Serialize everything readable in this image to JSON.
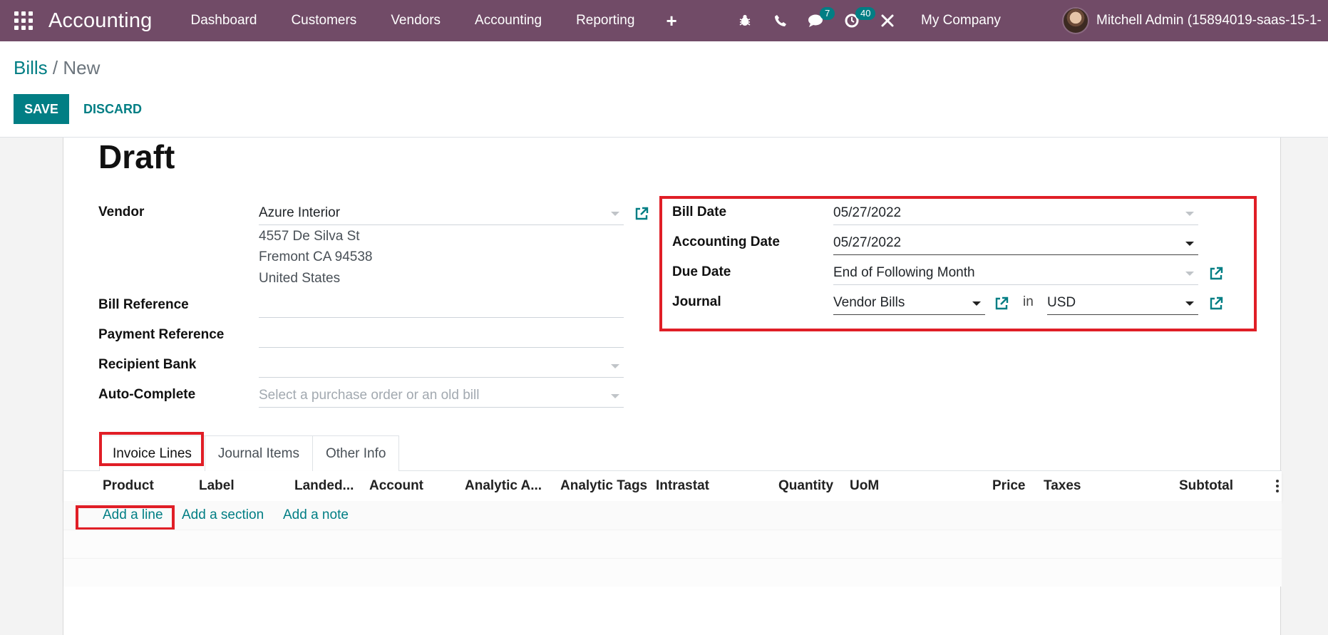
{
  "navbar": {
    "brand": "Accounting",
    "menu": [
      "Dashboard",
      "Customers",
      "Vendors",
      "Accounting",
      "Reporting"
    ],
    "plus": "+",
    "messages_count": "7",
    "activities_count": "40",
    "company": "My Company",
    "user": "Mitchell Admin (15894019-saas-15-1-",
    "bg_color": "#714b67"
  },
  "breadcrumb": {
    "parent": "Bills",
    "separator": "/",
    "current": "New"
  },
  "buttons": {
    "save": "SAVE",
    "discard": "DISCARD"
  },
  "status": "Draft",
  "form": {
    "vendor_label": "Vendor",
    "vendor_value": "Azure Interior",
    "vendor_address": [
      "4557 De Silva St",
      "Fremont CA 94538",
      "United States"
    ],
    "bill_reference_label": "Bill Reference",
    "bill_reference_value": "",
    "payment_reference_label": "Payment Reference",
    "payment_reference_value": "",
    "recipient_bank_label": "Recipient Bank",
    "recipient_bank_value": "",
    "auto_complete_label": "Auto-Complete",
    "auto_complete_placeholder": "Select a purchase order or an old bill",
    "bill_date_label": "Bill Date",
    "bill_date_value": "05/27/2022",
    "accounting_date_label": "Accounting Date",
    "accounting_date_value": "05/27/2022",
    "due_date_label": "Due Date",
    "due_date_value": "End of Following Month",
    "journal_label": "Journal",
    "journal_value": "Vendor Bills",
    "in_text": "in",
    "currency_value": "USD"
  },
  "tabs": [
    "Invoice Lines",
    "Journal Items",
    "Other Info"
  ],
  "table": {
    "columns": [
      "Product",
      "Label",
      "Landed...",
      "Account",
      "Analytic A...",
      "Analytic Tags",
      "Intrastat",
      "Quantity",
      "UoM",
      "Price",
      "Taxes",
      "Subtotal"
    ],
    "add_line": "Add a line",
    "add_section": "Add a section",
    "add_note": "Add a note"
  },
  "colors": {
    "accent": "#017e84",
    "highlight": "#e01e26"
  }
}
